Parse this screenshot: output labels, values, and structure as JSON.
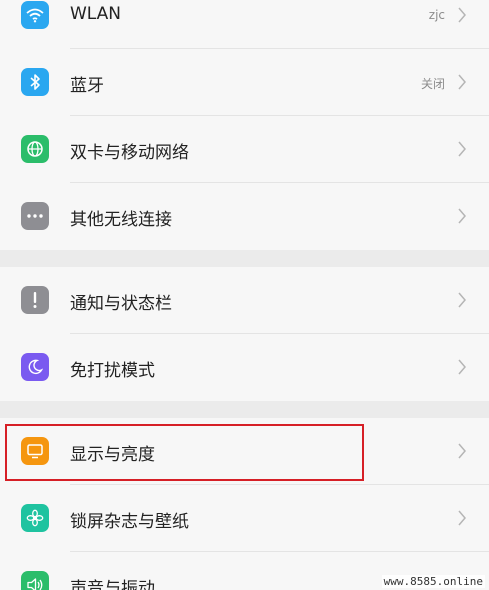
{
  "settings": {
    "items": [
      {
        "id": "wlan",
        "label": "WLAN",
        "value": "zjc",
        "icon": "wifi-icon",
        "color": "#2aa7f0"
      },
      {
        "id": "bluetooth",
        "label": "蓝牙",
        "value": "关闭",
        "icon": "bluetooth-icon",
        "color": "#2aa7f0"
      },
      {
        "id": "dual-sim",
        "label": "双卡与移动网络",
        "value": "",
        "icon": "globe-icon",
        "color": "#2bbd6a"
      },
      {
        "id": "more-wireless",
        "label": "其他无线连接",
        "value": "",
        "icon": "more-icon",
        "color": "#8e8e93"
      },
      {
        "id": "notifications",
        "label": "通知与状态栏",
        "value": "",
        "icon": "exclamation-icon",
        "color": "#8e8e93"
      },
      {
        "id": "dnd",
        "label": "免打扰模式",
        "value": "",
        "icon": "moon-icon",
        "color": "#7a5af0"
      },
      {
        "id": "display",
        "label": "显示与亮度",
        "value": "",
        "icon": "monitor-icon",
        "color": "#f5960f"
      },
      {
        "id": "lockscreen",
        "label": "锁屏杂志与壁纸",
        "value": "",
        "icon": "flower-icon",
        "color": "#1fc3a0"
      },
      {
        "id": "sound",
        "label": "声音与振动",
        "value": "",
        "icon": "speaker-icon",
        "color": "#2bbd6a"
      }
    ]
  },
  "watermark": "www.8585.online",
  "colors": {
    "highlight": "#d61f26",
    "background": "#f7f7f7",
    "section_gap": "#ebebeb"
  }
}
